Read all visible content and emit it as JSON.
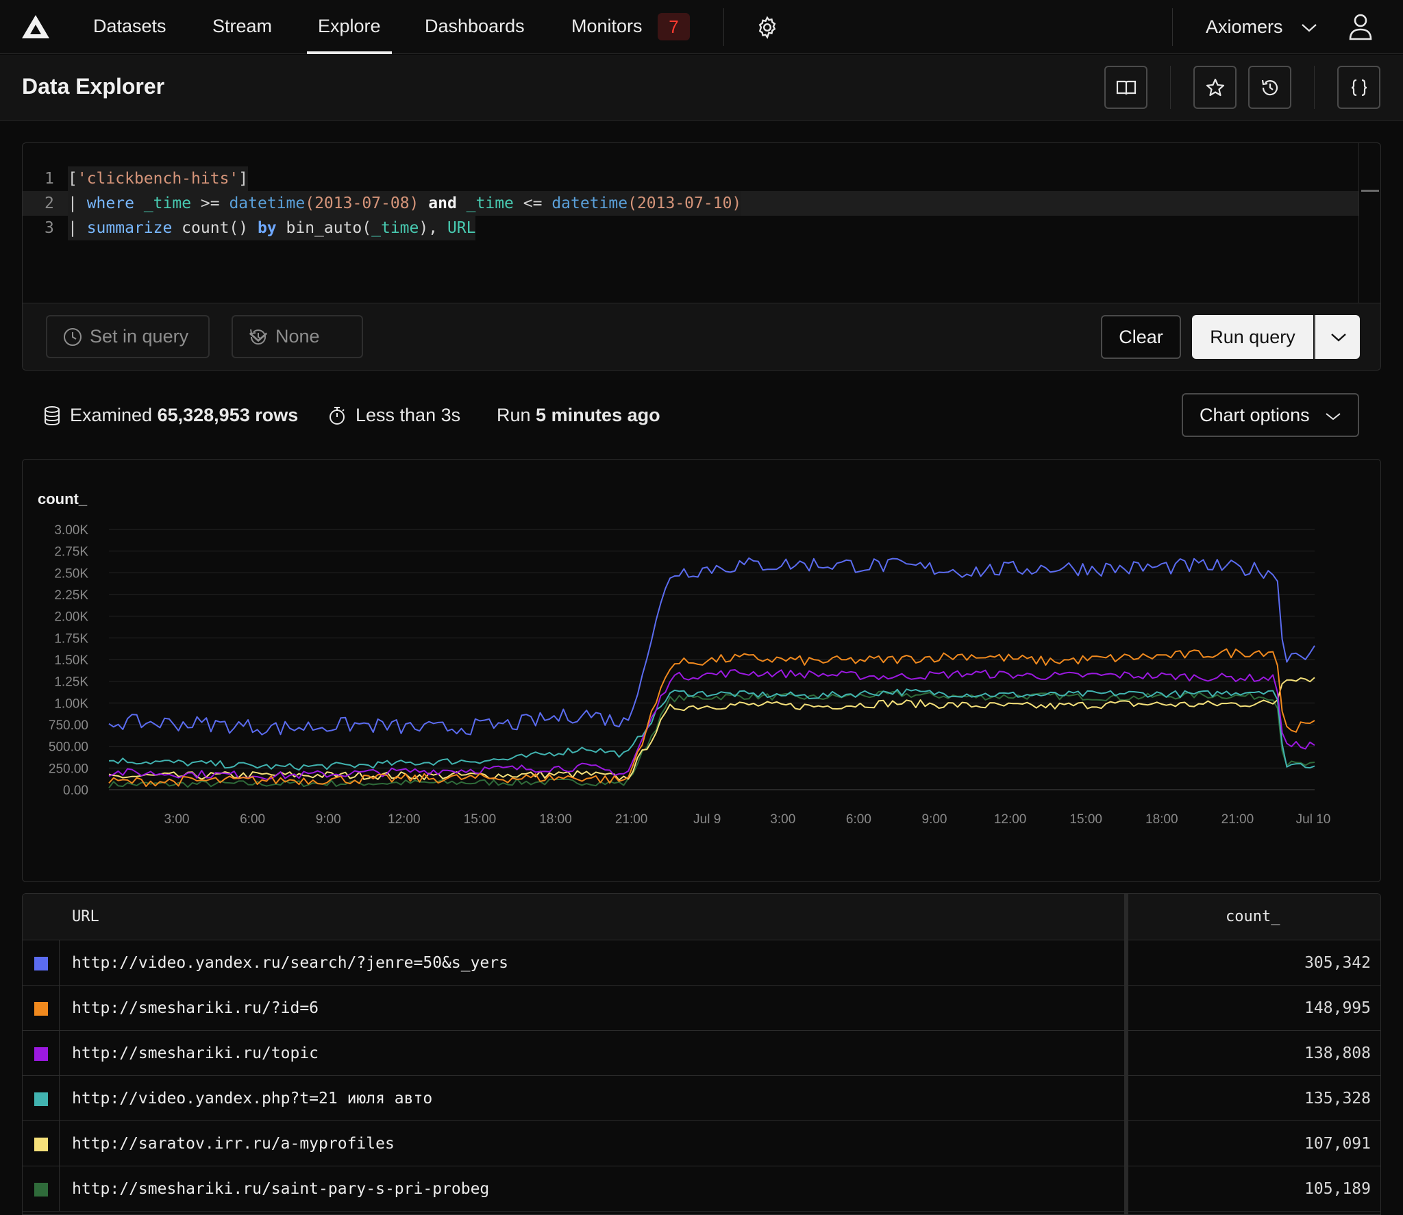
{
  "nav": {
    "items": [
      {
        "label": "Datasets"
      },
      {
        "label": "Stream"
      },
      {
        "label": "Explore"
      },
      {
        "label": "Dashboards"
      },
      {
        "label": "Monitors"
      }
    ],
    "active": "Explore",
    "monitors_badge": "7",
    "org_name": "Axiomers"
  },
  "header": {
    "title": "Data Explorer",
    "icons": [
      "book-icon",
      "star-icon",
      "history-icon",
      "braces-icon"
    ]
  },
  "editor": {
    "lines": [
      {
        "num": "1",
        "tokens": [
          {
            "t": "[",
            "c": "op"
          },
          {
            "t": "'clickbench-hits'",
            "c": "str"
          },
          {
            "t": "]",
            "c": "op"
          }
        ]
      },
      {
        "num": "2",
        "tokens": [
          {
            "t": "| ",
            "c": "op"
          },
          {
            "t": "where",
            "c": "kw"
          },
          {
            "t": " ",
            "c": "op"
          },
          {
            "t": "_time",
            "c": "id"
          },
          {
            "t": " >= ",
            "c": "op"
          },
          {
            "t": "datetime",
            "c": "fn"
          },
          {
            "t": "(2013-07-08)",
            "c": "num"
          },
          {
            "t": " ",
            "c": "op"
          },
          {
            "t": "and",
            "c": "bold"
          },
          {
            "t": " ",
            "c": "op"
          },
          {
            "t": "_time",
            "c": "id"
          },
          {
            "t": " <= ",
            "c": "op"
          },
          {
            "t": "datetime",
            "c": "fn"
          },
          {
            "t": "(2013-07-10)",
            "c": "num"
          }
        ]
      },
      {
        "num": "3",
        "tokens": [
          {
            "t": "| ",
            "c": "op"
          },
          {
            "t": "summarize",
            "c": "kw"
          },
          {
            "t": " count() ",
            "c": "plain"
          },
          {
            "t": "by",
            "c": "by"
          },
          {
            "t": " bin_auto(",
            "c": "plain"
          },
          {
            "t": "_time",
            "c": "id"
          },
          {
            "t": "), ",
            "c": "plain"
          },
          {
            "t": "URL",
            "c": "id"
          }
        ]
      }
    ],
    "time_range_label": "Set in query",
    "compare_label": "None",
    "clear_label": "Clear",
    "run_label": "Run query"
  },
  "stats": {
    "examined_prefix": "Examined",
    "examined_value": "65,328,953 rows",
    "duration": "Less than 3s",
    "run_prefix": "Run",
    "run_value": "5 minutes ago",
    "chart_options_label": "Chart options"
  },
  "chart_data": {
    "type": "line",
    "ylabel": "count_",
    "ylim": [
      0,
      3000
    ],
    "y_ticks": [
      "0.00",
      "250.00",
      "500.00",
      "750.00",
      "1.00K",
      "1.25K",
      "1.50K",
      "1.75K",
      "2.00K",
      "2.25K",
      "2.50K",
      "2.75K",
      "3.00K"
    ],
    "x_range_hours": [
      -1.67,
      45.5
    ],
    "x_ticks": [
      {
        "h": 2,
        "label": "3:00"
      },
      {
        "h": 5,
        "label": "6:00"
      },
      {
        "h": 8,
        "label": "9:00"
      },
      {
        "h": 11,
        "label": "12:00"
      },
      {
        "h": 14,
        "label": "15:00"
      },
      {
        "h": 17,
        "label": "18:00"
      },
      {
        "h": 20,
        "label": "21:00"
      },
      {
        "h": 23,
        "label": "Jul 9"
      },
      {
        "h": 26,
        "label": "3:00"
      },
      {
        "h": 29,
        "label": "6:00"
      },
      {
        "h": 32,
        "label": "9:00"
      },
      {
        "h": 35,
        "label": "12:00"
      },
      {
        "h": 38,
        "label": "15:00"
      },
      {
        "h": 41,
        "label": "18:00"
      },
      {
        "h": 44,
        "label": "21:00"
      },
      {
        "h": 47,
        "label": "Jul 10"
      }
    ],
    "grid": true,
    "legend": "table below",
    "series": [
      {
        "name": "http://video.yandex.ru/search/?jenre=50&s_yers",
        "color": "#5b6cf0",
        "x": [
          -1.67,
          2,
          5,
          8,
          11,
          14,
          17,
          18.6,
          20.3,
          23,
          26,
          29,
          32,
          35,
          38,
          41,
          44,
          44.3,
          45.5
        ],
        "y": [
          780,
          760,
          710,
          750,
          700,
          750,
          880,
          760,
          2500,
          2590,
          2600,
          2580,
          2520,
          2560,
          2550,
          2580,
          2520,
          1550,
          1600
        ]
      },
      {
        "name": "http://smeshariki.ru/?id=6",
        "color": "#f0891e",
        "x": [
          -1.67,
          5,
          11,
          17,
          18.6,
          20.3,
          23,
          26,
          29,
          32,
          35,
          38,
          41,
          44,
          44.3,
          45.5
        ],
        "y": [
          90,
          110,
          130,
          140,
          100,
          1450,
          1520,
          1480,
          1500,
          1550,
          1480,
          1520,
          1560,
          1600,
          700,
          750
        ]
      },
      {
        "name": "http://smeshariki.ru/topic",
        "color": "#9b19e0",
        "x": [
          -1.67,
          5,
          11,
          17,
          18.6,
          20.3,
          23,
          26,
          29,
          32,
          35,
          38,
          41,
          44,
          44.3,
          45.5
        ],
        "y": [
          200,
          160,
          220,
          260,
          180,
          1300,
          1350,
          1330,
          1300,
          1340,
          1310,
          1320,
          1300,
          1280,
          500,
          520
        ]
      },
      {
        "name": "http://video.yandex.php?t=21 июля авто",
        "color": "#41b3b0",
        "x": [
          -1.67,
          2,
          5,
          8,
          11,
          14,
          17,
          18.6,
          20.3,
          23,
          26,
          29,
          32,
          35,
          38,
          41,
          44,
          44.3,
          45.5
        ],
        "y": [
          340,
          300,
          260,
          280,
          320,
          350,
          480,
          400,
          1120,
          1100,
          1080,
          1130,
          1100,
          1090,
          1110,
          1100,
          1150,
          300,
          280
        ]
      },
      {
        "name": "http://saratov.irr.ru/a-myprofiles",
        "color": "#f5e07a",
        "x": [
          -1.67,
          5,
          11,
          17,
          18.6,
          20.3,
          23,
          26,
          29,
          32,
          35,
          38,
          41,
          44,
          44.3,
          45.5
        ],
        "y": [
          150,
          170,
          160,
          180,
          130,
          950,
          980,
          960,
          1000,
          970,
          960,
          990,
          980,
          1000,
          1300,
          1280
        ]
      },
      {
        "name": "http://smeshariki.ru/saint-pary-s-pri-probeg",
        "color": "#2f6b3a",
        "x": [
          -1.67,
          5,
          11,
          17,
          18.6,
          20.3,
          23,
          26,
          29,
          32,
          35,
          38,
          41,
          44,
          44.3,
          45.5
        ],
        "y": [
          60,
          70,
          80,
          90,
          70,
          1050,
          1080,
          1060,
          1100,
          1070,
          1080,
          1060,
          1090,
          1070,
          300,
          280
        ]
      }
    ]
  },
  "table": {
    "headers": [
      "URL",
      "count_"
    ],
    "rows": [
      {
        "url": "http://video.yandex.ru/search/?jenre=50&s_yers",
        "count": "305,342",
        "color": "#5b6cf0"
      },
      {
        "url": "http://smeshariki.ru/?id=6",
        "count": "148,995",
        "color": "#f0891e"
      },
      {
        "url": "http://smeshariki.ru/topic",
        "count": "138,808",
        "color": "#9b19e0"
      },
      {
        "url": "http://video.yandex.php?t=21 июля авто",
        "count": "135,328",
        "color": "#41b3b0"
      },
      {
        "url": "http://saratov.irr.ru/a-myprofiles",
        "count": "107,091",
        "color": "#f5e07a"
      },
      {
        "url": "http://smeshariki.ru/saint-pary-s-pri-probeg",
        "count": "105,189",
        "color": "#2f6b3a"
      }
    ]
  }
}
